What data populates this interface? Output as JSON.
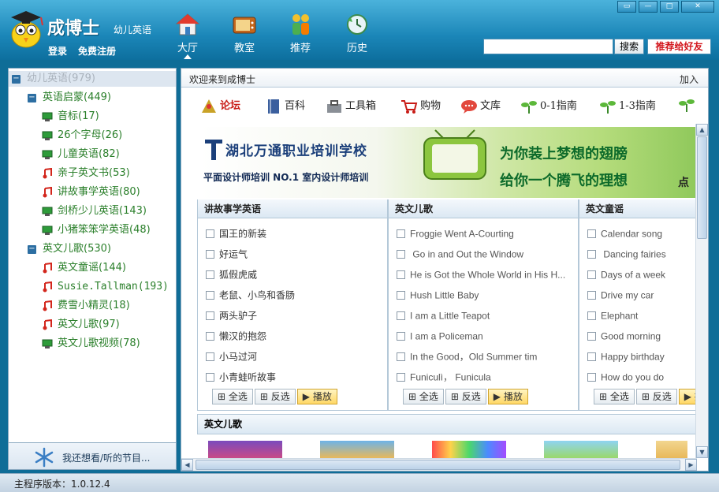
{
  "app": {
    "brand": "成博士",
    "brand_sub": "幼儿英语",
    "login": "登录",
    "register": "免费注册"
  },
  "window_controls": [
    "▭",
    "—",
    "□",
    "✕"
  ],
  "nav": [
    {
      "label": "大厅",
      "icon": "house-icon"
    },
    {
      "label": "教室",
      "icon": "tv-icon"
    },
    {
      "label": "推荐",
      "icon": "people-icon"
    },
    {
      "label": "历史",
      "icon": "history-icon"
    }
  ],
  "search": {
    "value": "",
    "button": "搜索",
    "recommend": "推荐给好友"
  },
  "sidebar": {
    "root": "幼儿英语(979)",
    "groups": [
      {
        "label": "英语启蒙(449)",
        "items": [
          {
            "label": "音标(17)",
            "icon": "video"
          },
          {
            "label": "26个字母(26)",
            "icon": "video"
          },
          {
            "label": "儿童英语(82)",
            "icon": "video"
          },
          {
            "label": "亲子英文书(53)",
            "icon": "music"
          },
          {
            "label": "讲故事学英语(80)",
            "icon": "music"
          },
          {
            "label": "剑桥少儿英语(143)",
            "icon": "video"
          },
          {
            "label": "小猪笨笨学英语(48)",
            "icon": "video"
          }
        ]
      },
      {
        "label": "英文儿歌(530)",
        "items": [
          {
            "label": "英文童谣(144)",
            "icon": "music"
          },
          {
            "label": "Susie.Tallman(193)",
            "icon": "music"
          },
          {
            "label": "费雪小精灵(18)",
            "icon": "music"
          },
          {
            "label": "英文儿歌(97)",
            "icon": "music"
          },
          {
            "label": "英文儿歌视频(78)",
            "icon": "video"
          }
        ]
      }
    ],
    "footer": "我还想看/听的节目..."
  },
  "content": {
    "tab_title": "欢迎来到成博士",
    "tab_add": "加入",
    "quicklinks": [
      "论坛",
      "百科",
      "工具箱",
      "购物",
      "文库",
      "0-1指南",
      "1-3指南"
    ],
    "banner": {
      "title": "湖北万通职业培训学校",
      "subtitle": "平面设计师培训 NO.1 室内设计师培训",
      "slogan1": "为你装上梦想的翅膀",
      "slogan2": "给你一个腾飞的理想",
      "more": "点"
    },
    "panels": [
      {
        "title": "讲故事学英语",
        "en": false,
        "items": [
          "国王的新装",
          "好运气",
          "狐假虎威",
          "老鼠、小鸟和香肠",
          "两头驴子",
          "懒汉的抱怨",
          "小马过河",
          "小青蛙听故事"
        ]
      },
      {
        "title": "英文儿歌",
        "en": true,
        "items": [
          "Froggie Went A-Courting",
          " Go in and Out the Window",
          "He is Got the Whole World in His H...",
          "Hush Little Baby",
          "I am a Little Teapot",
          "I am a Policeman",
          "In the Good，Old Summer tim",
          "Funiculì， Funicula"
        ]
      },
      {
        "title": "英文童谣",
        "en": true,
        "items": [
          "Calendar song",
          " Dancing fairies",
          "Days of a week",
          "Drive my car",
          "Elephant",
          "Good morning",
          "Happy birthday",
          "How do you do"
        ]
      }
    ],
    "panel_buttons": {
      "select_all": "全选",
      "invert": "反选",
      "play": "播放"
    },
    "section2_title": "英文儿歌"
  },
  "status": {
    "version": "主程序版本：1.0.12.4"
  },
  "colors": {
    "header": "#1b86b8",
    "tree_text": "#2a7f2a",
    "accent_red": "#d2141b"
  }
}
